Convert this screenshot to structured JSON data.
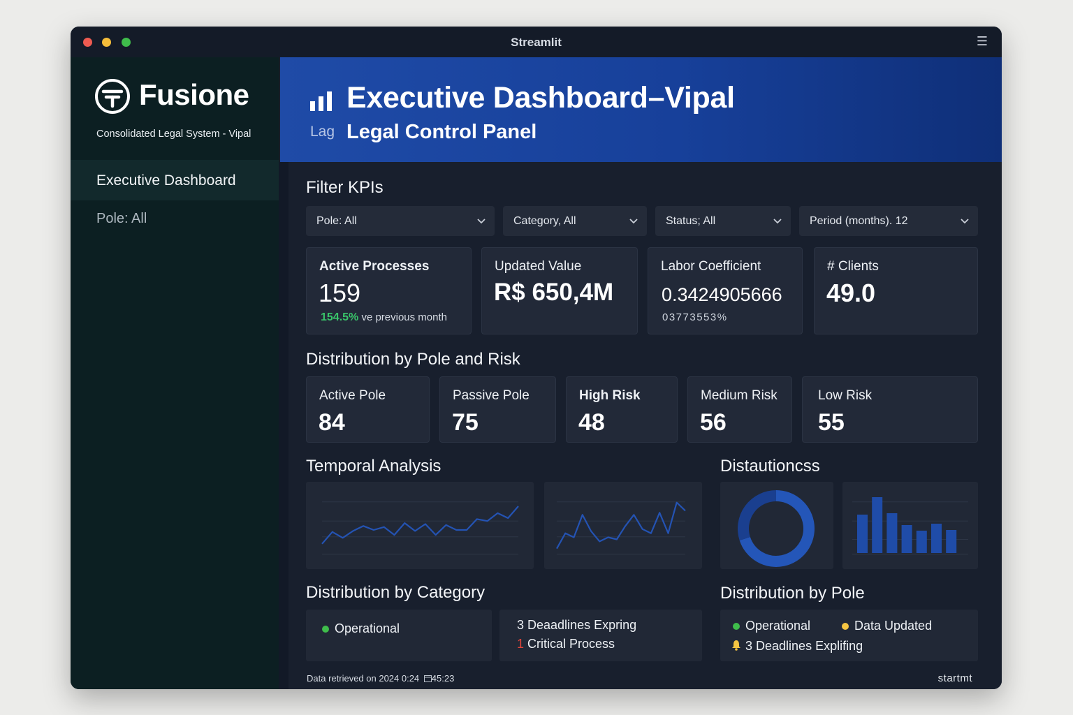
{
  "window": {
    "title": "Streamlit"
  },
  "sidebar": {
    "brand": "Fusione",
    "tagline": "Consolidated Legal System - Vipal",
    "nav_active": "Executive Dashboard",
    "nav_pole": "Pole: All"
  },
  "header": {
    "title": "Executive Dashboard–Vipal",
    "prefix": "Lag",
    "subtitle": "Legal Control Panel"
  },
  "filters": {
    "title": "Filter KPIs",
    "pole": "Pole: All",
    "category": "Category, All",
    "status": "Status; All",
    "period": "Period (months). 12"
  },
  "kpis": {
    "active_processes": {
      "label": "Active Processes",
      "value": "159",
      "delta_pct": "154.5%",
      "delta_text": "ve previous month"
    },
    "updated_value": {
      "label": "Updated Value",
      "value": "R$ 650,4M"
    },
    "labor_coefficient": {
      "label": "Labor Coefficient",
      "value": "0.3424905666",
      "sub": "03773553%"
    },
    "clients": {
      "label": "# Clients",
      "value": "49.0"
    }
  },
  "distribution": {
    "title": "Distribution by Pole and Risk",
    "active_pole": {
      "label": "Active Pole",
      "value": "84"
    },
    "passive_pole": {
      "label": "Passive Pole",
      "value": "75"
    },
    "high_risk": {
      "label": "High Risk",
      "value": "48"
    },
    "medium_risk": {
      "label": "Medium Risk",
      "value": "56"
    },
    "low_risk": {
      "label": "Low Risk",
      "value": "55"
    }
  },
  "temporal": {
    "title": "Temporal Analysis"
  },
  "dist_right": {
    "title": "Distautioncss"
  },
  "category": {
    "title": "Distribution by Category",
    "operational": "Operational",
    "deadlines": "3 Deaadlines Expring",
    "critical_num": "1",
    "critical_text": "Critical Process"
  },
  "pole_dist": {
    "title": "Distribution by Pole",
    "operational": "Operational",
    "data_updated": "Data Updated",
    "deadlines": "3 Deadlines Expliﬁng"
  },
  "footer": {
    "retrieved": "Data retrieved on 2024 0:24",
    "time": "45:23",
    "right": "startmt"
  },
  "colors": {
    "accent_blue": "#1f4ba7",
    "chart_blue": "#2453b3",
    "positive": "#39c46a",
    "status_green": "#3fbd4b",
    "status_yellow": "#f5c542",
    "critical_red": "#e0443a"
  },
  "chart_data": [
    {
      "type": "line",
      "x": [
        1,
        2,
        3,
        4,
        5,
        6,
        7,
        8,
        9,
        10,
        11,
        12,
        13,
        14,
        15,
        16,
        17,
        18,
        19,
        20
      ],
      "series": [
        {
          "values": [
            10,
            22,
            16,
            23,
            28,
            24,
            27,
            19,
            31,
            23,
            30,
            19,
            29,
            24,
            24,
            35,
            33,
            41,
            36,
            48
          ]
        }
      ],
      "ylim": [
        0,
        60
      ]
    },
    {
      "type": "line",
      "x": [
        1,
        2,
        3,
        4,
        5,
        6,
        7,
        8,
        9,
        10,
        11,
        12,
        13,
        14,
        15,
        16
      ],
      "series": [
        {
          "values": [
            5,
            20,
            16,
            38,
            22,
            12,
            16,
            14,
            27,
            38,
            24,
            20,
            40,
            20,
            50,
            42
          ]
        }
      ],
      "ylim": [
        0,
        60
      ]
    },
    {
      "type": "pie",
      "values": [
        70,
        30
      ]
    },
    {
      "type": "bar",
      "values": [
        55,
        80,
        57,
        40,
        32,
        42,
        33
      ]
    }
  ]
}
